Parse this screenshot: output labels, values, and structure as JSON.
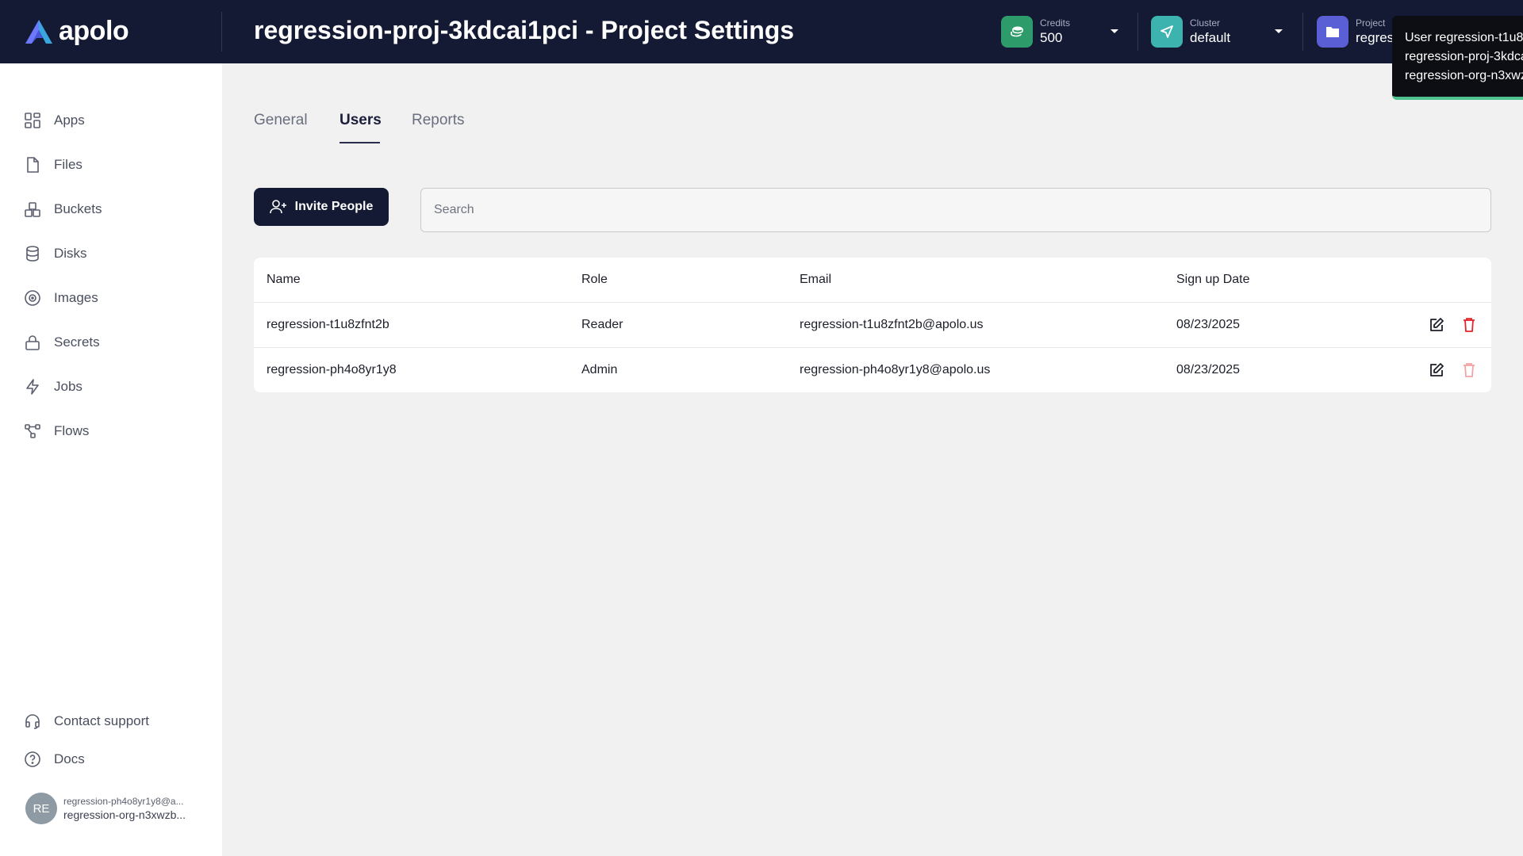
{
  "header": {
    "logo_text": "apolo",
    "title": "regression-proj-3kdcai1pci - Project Settings",
    "credits": {
      "label": "Credits",
      "value": "500",
      "color": "#2e9b6a"
    },
    "cluster": {
      "label": "Cluster",
      "value": "default",
      "color": "#3db3b0"
    },
    "project": {
      "label": "Project",
      "value": "regres",
      "color": "#5b5fd6"
    }
  },
  "tooltip": {
    "lines": [
      "User regression-t1u8",
      "regression-proj-3kdca",
      "regression-org-n3xwz"
    ]
  },
  "sidebar": {
    "items": [
      {
        "label": "Apps",
        "icon": "apps-icon"
      },
      {
        "label": "Files",
        "icon": "file-icon"
      },
      {
        "label": "Buckets",
        "icon": "buckets-icon"
      },
      {
        "label": "Disks",
        "icon": "database-icon"
      },
      {
        "label": "Images",
        "icon": "disc-icon"
      },
      {
        "label": "Secrets",
        "icon": "lock-icon"
      },
      {
        "label": "Jobs",
        "icon": "lightning-icon"
      },
      {
        "label": "Flows",
        "icon": "flow-icon"
      }
    ],
    "support": {
      "label": "Contact support",
      "icon": "headset-icon"
    },
    "docs": {
      "label": "Docs",
      "icon": "help-circle-icon"
    },
    "user": {
      "initials": "RE",
      "email": "regression-ph4o8yr1y8@a...",
      "org": "regression-org-n3xwzb..."
    }
  },
  "tabs": [
    {
      "label": "General",
      "active": false
    },
    {
      "label": "Users",
      "active": true
    },
    {
      "label": "Reports",
      "active": false
    }
  ],
  "toolbar": {
    "invite_label": "Invite People",
    "search_placeholder": "Search"
  },
  "table": {
    "columns": [
      "Name",
      "Role",
      "Email",
      "Sign up Date"
    ],
    "rows": [
      {
        "name": "regression-t1u8zfnt2b",
        "role": "Reader",
        "email": "regression-t1u8zfnt2b@apolo.us",
        "date": "08/23/2025",
        "delete_enabled": true
      },
      {
        "name": "regression-ph4o8yr1y8",
        "role": "Admin",
        "email": "regression-ph4o8yr1y8@apolo.us",
        "date": "08/23/2025",
        "delete_enabled": false
      }
    ]
  },
  "colors": {
    "header_bg": "#141a33",
    "delete_red": "#e0262d",
    "delete_disabled": "#f2a3a6",
    "accent_green": "#4ec28f"
  }
}
